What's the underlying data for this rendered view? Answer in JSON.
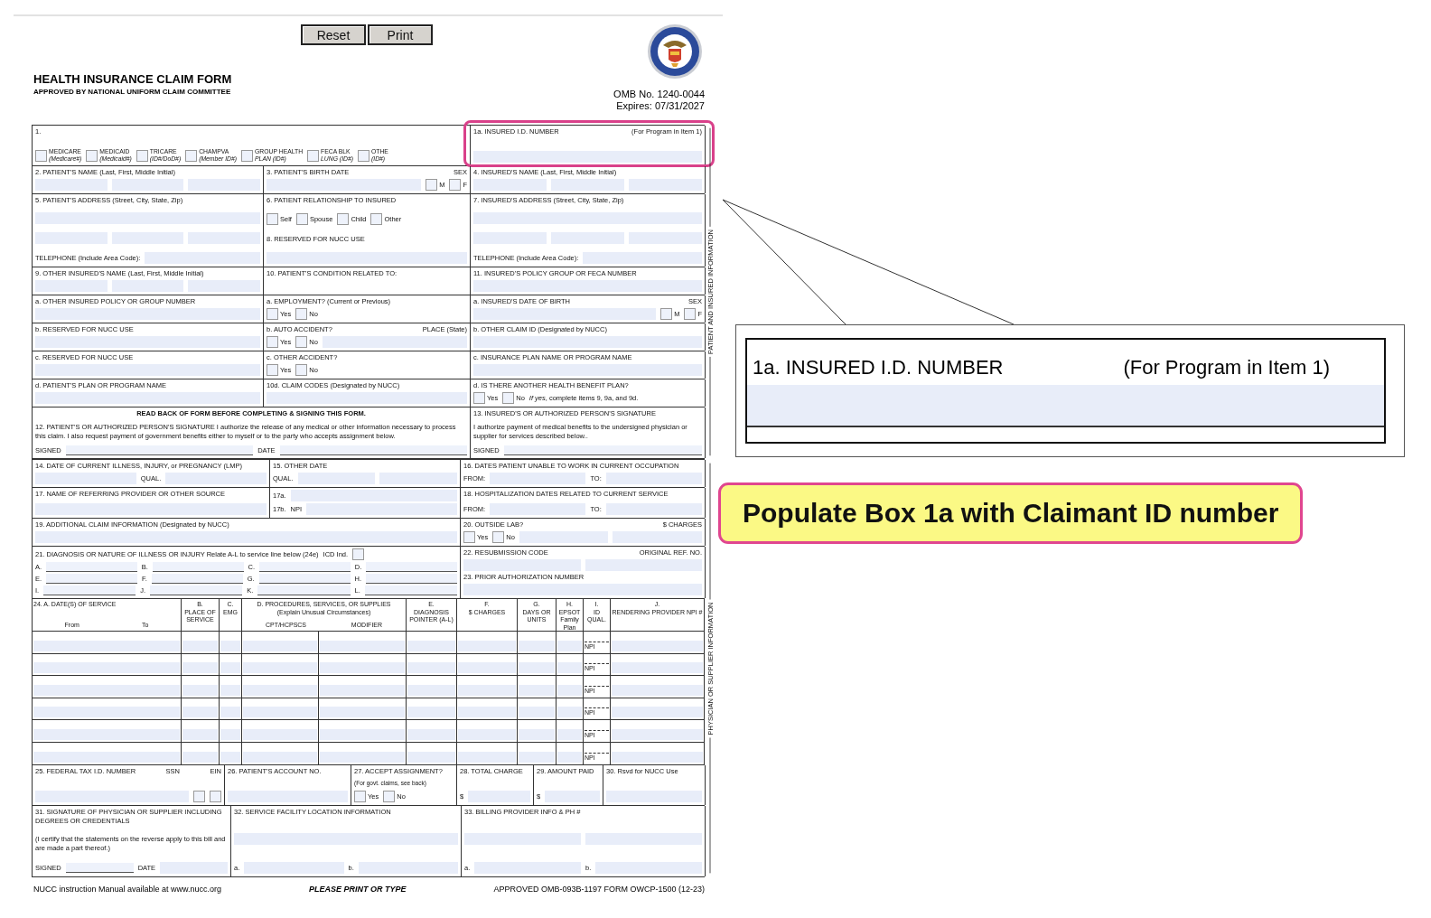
{
  "toolbar": {
    "buttons": [
      "Reset",
      "Print"
    ]
  },
  "header": {
    "title": "HEALTH INSURANCE CLAIM FORM",
    "subtitle": "APPROVED BY NATIONAL UNIFORM CLAIM COMMITTEE",
    "omb": "OMB No. 1240-0044",
    "expires": "Expires:  07/31/2027"
  },
  "form": {
    "sections": [
      {
        "side_label": "PATIENT AND INSURED INFORMATION",
        "rows": [
          {
            "kind": "cells",
            "cells": [
              {
                "highlighted": false,
                "lines": [
                  [
                    {
                      "kind": "label",
                      "text": "1."
                    }
                  ],
                  [
                    {
                      "kind": "check",
                      "label": "MEDICARE",
                      "sublabel": "(Medicare#)",
                      "checked": false
                    },
                    {
                      "kind": "check",
                      "label": "MEDICAID",
                      "sublabel": "(Medicaid#)",
                      "checked": false
                    },
                    {
                      "kind": "check",
                      "label": "TRICARE",
                      "sublabel": "(ID#/DoD#)",
                      "checked": false
                    },
                    {
                      "kind": "check",
                      "label": "CHAMPVA",
                      "sublabel": "(Member ID#)",
                      "checked": false
                    },
                    {
                      "kind": "check",
                      "label": "GROUP HEALTH",
                      "sublabel": "PLAN (ID#)",
                      "checked": false
                    },
                    {
                      "kind": "check",
                      "label": "FECA BLK",
                      "sublabel": "LUNG (ID#)",
                      "checked": false
                    },
                    {
                      "kind": "check",
                      "label": "OTHE",
                      "sublabel": "(ID#)",
                      "checked": false
                    }
                  ]
                ]
              },
              {
                "highlighted": true,
                "lines": [
                  [
                    {
                      "kind": "label",
                      "text": "1a. INSURED I.D. NUMBER"
                    },
                    {
                      "kind": "label",
                      "text": "(For Program in Item 1)"
                    }
                  ],
                  [
                    {
                      "kind": "field"
                    }
                  ]
                ]
              }
            ]
          },
          {
            "kind": "cells",
            "cells": [
              {
                "highlighted": false,
                "lines": [
                  [
                    {
                      "kind": "label",
                      "text": "2. PATIENT'S NAME (Last, First, Middle Initial)"
                    }
                  ],
                  [
                    {
                      "kind": "field"
                    },
                    {
                      "kind": "field"
                    },
                    {
                      "kind": "field"
                    }
                  ]
                ]
              },
              {
                "highlighted": false,
                "lines": [
                  [
                    {
                      "kind": "label",
                      "text": "3. PATIENT'S BIRTH DATE"
                    },
                    {
                      "kind": "label",
                      "text": "SEX"
                    }
                  ],
                  [
                    {
                      "kind": "field"
                    },
                    {
                      "kind": "check",
                      "label": "M",
                      "checked": false
                    },
                    {
                      "kind": "check",
                      "label": "F",
                      "checked": false
                    }
                  ]
                ]
              },
              {
                "highlighted": false,
                "lines": [
                  [
                    {
                      "kind": "label",
                      "text": "4. INSURED'S NAME (Last, First, Middle Initial)"
                    }
                  ],
                  [
                    {
                      "kind": "field"
                    },
                    {
                      "kind": "field"
                    },
                    {
                      "kind": "field"
                    }
                  ]
                ]
              }
            ]
          },
          {
            "kind": "cells",
            "cells": [
              {
                "highlighted": false,
                "lines": [
                  [
                    {
                      "kind": "label",
                      "text": "5. PATIENT'S ADDRESS (Street, City, State, Zip)"
                    }
                  ],
                  [
                    {
                      "kind": "field"
                    }
                  ],
                  [
                    {
                      "kind": "field"
                    },
                    {
                      "kind": "field"
                    },
                    {
                      "kind": "field"
                    }
                  ],
                  [
                    {
                      "kind": "label",
                      "text": "TELEPHONE (Include Area Code):"
                    },
                    {
                      "kind": "field"
                    }
                  ]
                ]
              },
              {
                "highlighted": false,
                "lines": [
                  [
                    {
                      "kind": "label",
                      "text": "6. PATIENT RELATIONSHIP TO INSURED"
                    }
                  ],
                  [
                    {
                      "kind": "check",
                      "label": "Self",
                      "checked": false
                    },
                    {
                      "kind": "check",
                      "label": "Spouse",
                      "checked": false
                    },
                    {
                      "kind": "check",
                      "label": "Child",
                      "checked": false
                    },
                    {
                      "kind": "check",
                      "label": "Other",
                      "checked": false
                    }
                  ],
                  [
                    {
                      "kind": "label",
                      "text": "8. RESERVED FOR NUCC USE"
                    }
                  ],
                  [
                    {
                      "kind": "field"
                    }
                  ]
                ]
              },
              {
                "highlighted": false,
                "lines": [
                  [
                    {
                      "kind": "label",
                      "text": "7. INSURED'S ADDRESS (Street, City, State, Zip)"
                    }
                  ],
                  [
                    {
                      "kind": "field"
                    }
                  ],
                  [
                    {
                      "kind": "field"
                    },
                    {
                      "kind": "field"
                    },
                    {
                      "kind": "field"
                    }
                  ],
                  [
                    {
                      "kind": "label",
                      "text": "TELEPHONE (Include Area Code):"
                    },
                    {
                      "kind": "field"
                    }
                  ]
                ]
              }
            ]
          },
          {
            "kind": "cells",
            "cells": [
              {
                "highlighted": false,
                "lines": [
                  [
                    {
                      "kind": "label",
                      "text": "9. OTHER INSURED'S NAME (Last, First, Middle Initial)"
                    }
                  ],
                  [
                    {
                      "kind": "field"
                    },
                    {
                      "kind": "field"
                    },
                    {
                      "kind": "field"
                    }
                  ]
                ]
              },
              {
                "highlighted": false,
                "lines": [
                  [
                    {
                      "kind": "label",
                      "text": "10. PATIENT'S CONDITION RELATED TO:"
                    }
                  ]
                ]
              },
              {
                "highlighted": false,
                "lines": [
                  [
                    {
                      "kind": "label",
                      "text": "11. INSURED'S POLICY GROUP OR FECA NUMBER"
                    }
                  ],
                  [
                    {
                      "kind": "field"
                    }
                  ]
                ]
              }
            ]
          },
          {
            "kind": "cells",
            "cells": [
              {
                "highlighted": false,
                "lines": [
                  [
                    {
                      "kind": "label",
                      "text": "a. OTHER INSURED POLICY OR GROUP NUMBER"
                    }
                  ],
                  [
                    {
                      "kind": "field"
                    }
                  ]
                ]
              },
              {
                "highlighted": false,
                "lines": [
                  [
                    {
                      "kind": "label",
                      "text": "a. EMPLOYMENT? (Current or Previous)"
                    }
                  ],
                  [
                    {
                      "kind": "check",
                      "label": "Yes",
                      "checked": false
                    },
                    {
                      "kind": "check",
                      "label": "No",
                      "checked": false
                    }
                  ]
                ]
              },
              {
                "highlighted": false,
                "lines": [
                  [
                    {
                      "kind": "label",
                      "text": "a. INSURED'S DATE OF BIRTH"
                    },
                    {
                      "kind": "label",
                      "text": "SEX"
                    }
                  ],
                  [
                    {
                      "kind": "field"
                    },
                    {
                      "kind": "check",
                      "label": "M",
                      "checked": false
                    },
                    {
                      "kind": "check",
                      "label": "F",
                      "checked": false
                    }
                  ]
                ]
              }
            ]
          },
          {
            "kind": "cells",
            "cells": [
              {
                "highlighted": false,
                "lines": [
                  [
                    {
                      "kind": "label",
                      "text": "b. RESERVED FOR NUCC USE"
                    }
                  ],
                  [
                    {
                      "kind": "field"
                    }
                  ]
                ]
              },
              {
                "highlighted": false,
                "lines": [
                  [
                    {
                      "kind": "label",
                      "text": "b. AUTO ACCIDENT?"
                    },
                    {
                      "kind": "label",
                      "text": "PLACE (State)"
                    }
                  ],
                  [
                    {
                      "kind": "check",
                      "label": "Yes",
                      "checked": false
                    },
                    {
                      "kind": "check",
                      "label": "No",
                      "checked": false
                    },
                    {
                      "kind": "field"
                    }
                  ]
                ]
              },
              {
                "highlighted": false,
                "lines": [
                  [
                    {
                      "kind": "label",
                      "text": "b. OTHER CLAIM ID (Designated by NUCC)"
                    }
                  ],
                  [
                    {
                      "kind": "field"
                    }
                  ]
                ]
              }
            ]
          },
          {
            "kind": "cells",
            "cells": [
              {
                "highlighted": false,
                "lines": [
                  [
                    {
                      "kind": "label",
                      "text": "c. RESERVED FOR NUCC USE"
                    }
                  ],
                  [
                    {
                      "kind": "field"
                    }
                  ]
                ]
              },
              {
                "highlighted": false,
                "lines": [
                  [
                    {
                      "kind": "label",
                      "text": "c. OTHER ACCIDENT?"
                    }
                  ],
                  [
                    {
                      "kind": "check",
                      "label": "Yes",
                      "checked": false
                    },
                    {
                      "kind": "check",
                      "label": "No",
                      "checked": false
                    }
                  ]
                ]
              },
              {
                "highlighted": false,
                "lines": [
                  [
                    {
                      "kind": "label",
                      "text": "c. INSURANCE PLAN NAME OR PROGRAM NAME"
                    }
                  ],
                  [
                    {
                      "kind": "field"
                    }
                  ]
                ]
              }
            ]
          },
          {
            "kind": "cells",
            "cells": [
              {
                "highlighted": false,
                "lines": [
                  [
                    {
                      "kind": "label",
                      "text": "d. PATIENT'S PLAN OR PROGRAM NAME"
                    }
                  ],
                  [
                    {
                      "kind": "field"
                    }
                  ]
                ]
              },
              {
                "highlighted": false,
                "lines": [
                  [
                    {
                      "kind": "label",
                      "text": "10d. CLAIM CODES (Designated by NUCC)"
                    }
                  ],
                  [
                    {
                      "kind": "field"
                    }
                  ]
                ]
              },
              {
                "highlighted": false,
                "lines": [
                  [
                    {
                      "kind": "label",
                      "text": "d. IS THERE ANOTHER HEALTH BENEFIT PLAN?"
                    }
                  ],
                  [
                    {
                      "kind": "check",
                      "label": "Yes",
                      "checked": false
                    },
                    {
                      "kind": "check",
                      "label": "No",
                      "checked": false
                    },
                    {
                      "kind": "label",
                      "text": "*If yes*, complete items 9, 9a, and 9d."
                    }
                  ]
                ]
              }
            ]
          },
          {
            "kind": "cells",
            "cells": [
              {
                "highlighted": false,
                "lines": [
                  [
                    {
                      "kind": "bold",
                      "text": "READ BACK OF FORM BEFORE COMPLETING & SIGNING THIS FORM."
                    }
                  ],
                  [
                    {
                      "kind": "para",
                      "text": "12. PATIENT'S OR AUTHORIZED PERSON'S SIGNATURE I authorize the release of any medical or other information necessary to process this claim. I also request payment of government benefits either to myself or to the party who accepts assignment below."
                    }
                  ],
                  [
                    {
                      "kind": "label",
                      "text": "SIGNED"
                    },
                    {
                      "kind": "line"
                    },
                    {
                      "kind": "label",
                      "text": "DATE"
                    },
                    {
                      "kind": "line"
                    }
                  ]
                ]
              },
              {
                "highlighted": false,
                "lines": [
                  [
                    {
                      "kind": "label",
                      "text": "13. INSURED'S OR AUTHORIZED PERSON'S SIGNATURE"
                    }
                  ],
                  [
                    {
                      "kind": "para",
                      "text": "I authorize payment of medical benefits to the undersigned physician or supplier for services described below.."
                    }
                  ],
                  [
                    {
                      "kind": "label",
                      "text": "SIGNED"
                    },
                    {
                      "kind": "line"
                    }
                  ]
                ]
              }
            ]
          }
        ]
      },
      {
        "side_label": "PHYSICIAN OR SUPPLIER INFORMATION",
        "rows": [
          {
            "kind": "cells",
            "cells": [
              {
                "highlighted": false,
                "lines": [
                  [
                    {
                      "kind": "label",
                      "text": "14. DATE OF CURRENT ILLNESS, INJURY, or PREGNANCY (LMP)"
                    }
                  ],
                  [
                    {
                      "kind": "field"
                    },
                    {
                      "kind": "label",
                      "text": "QUAL."
                    },
                    {
                      "kind": "field"
                    }
                  ]
                ]
              },
              {
                "highlighted": false,
                "lines": [
                  [
                    {
                      "kind": "label",
                      "text": "15. OTHER DATE"
                    }
                  ],
                  [
                    {
                      "kind": "label",
                      "text": "QUAL."
                    },
                    {
                      "kind": "field"
                    },
                    {
                      "kind": "field"
                    }
                  ]
                ]
              },
              {
                "highlighted": false,
                "lines": [
                  [
                    {
                      "kind": "label",
                      "text": "16. DATES PATIENT UNABLE TO WORK IN CURRENT OCCUPATION"
                    }
                  ],
                  [
                    {
                      "kind": "label",
                      "text": "FROM:"
                    },
                    {
                      "kind": "field"
                    },
                    {
                      "kind": "label",
                      "text": "TO:"
                    },
                    {
                      "kind": "field"
                    }
                  ]
                ]
              }
            ]
          },
          {
            "kind": "cells",
            "cells": [
              {
                "highlighted": false,
                "lines": [
                  [
                    {
                      "kind": "label",
                      "text": "17. NAME OF REFERRING PROVIDER OR OTHER SOURCE"
                    }
                  ],
                  [
                    {
                      "kind": "field"
                    }
                  ]
                ]
              },
              {
                "highlighted": false,
                "lines": [
                  [
                    {
                      "kind": "label",
                      "text": "17a."
                    },
                    {
                      "kind": "field"
                    }
                  ],
                  [
                    {
                      "kind": "label",
                      "text": "17b."
                    },
                    {
                      "kind": "label",
                      "text": "NPI"
                    },
                    {
                      "kind": "field"
                    }
                  ]
                ]
              },
              {
                "highlighted": false,
                "lines": [
                  [
                    {
                      "kind": "label",
                      "text": "18. HOSPITALIZATION DATES RELATED TO CURRENT SERVICE"
                    }
                  ],
                  [
                    {
                      "kind": "label",
                      "text": "FROM:"
                    },
                    {
                      "kind": "field"
                    },
                    {
                      "kind": "label",
                      "text": "TO:"
                    },
                    {
                      "kind": "field"
                    }
                  ]
                ]
              }
            ]
          },
          {
            "kind": "cells",
            "cells": [
              {
                "highlighted": false,
                "lines": [
                  [
                    {
                      "kind": "label",
                      "text": "19. ADDITIONAL CLAIM INFORMATION (Designated by NUCC)"
                    }
                  ],
                  [
                    {
                      "kind": "field"
                    }
                  ]
                ]
              },
              {
                "highlighted": false,
                "lines": [
                  [
                    {
                      "kind": "label",
                      "text": "20. OUTSIDE LAB?"
                    },
                    {
                      "kind": "label",
                      "text": "$ CHARGES"
                    }
                  ],
                  [
                    {
                      "kind": "check",
                      "label": "Yes",
                      "checked": false
                    },
                    {
                      "kind": "check",
                      "label": "No",
                      "checked": false
                    },
                    {
                      "kind": "field"
                    },
                    {
                      "kind": "field"
                    }
                  ]
                ]
              }
            ]
          },
          {
            "kind": "cells",
            "cells": [
              {
                "highlighted": false,
                "lines": [
                  [
                    {
                      "kind": "label",
                      "text": "21. DIAGNOSIS OR NATURE OF ILLNESS OR INJURY Relate A-L to service line below (24e)"
                    },
                    {
                      "kind": "label",
                      "text": "ICD Ind."
                    },
                    {
                      "kind": "check",
                      "checked": false
                    }
                  ],
                  [
                    {
                      "kind": "label",
                      "text": "A."
                    },
                    {
                      "kind": "line"
                    },
                    {
                      "kind": "label",
                      "text": "B."
                    },
                    {
                      "kind": "line"
                    },
                    {
                      "kind": "label",
                      "text": "C."
                    },
                    {
                      "kind": "line"
                    },
                    {
                      "kind": "label",
                      "text": "D."
                    },
                    {
                      "kind": "line"
                    }
                  ],
                  [
                    {
                      "kind": "label",
                      "text": "E."
                    },
                    {
                      "kind": "line"
                    },
                    {
                      "kind": "label",
                      "text": "F."
                    },
                    {
                      "kind": "line"
                    },
                    {
                      "kind": "label",
                      "text": "G."
                    },
                    {
                      "kind": "line"
                    },
                    {
                      "kind": "label",
                      "text": "H."
                    },
                    {
                      "kind": "line"
                    }
                  ],
                  [
                    {
                      "kind": "label",
                      "text": "I."
                    },
                    {
                      "kind": "line"
                    },
                    {
                      "kind": "label",
                      "text": "J."
                    },
                    {
                      "kind": "line"
                    },
                    {
                      "kind": "label",
                      "text": "K."
                    },
                    {
                      "kind": "line"
                    },
                    {
                      "kind": "label",
                      "text": "L."
                    },
                    {
                      "kind": "line"
                    }
                  ]
                ]
              },
              {
                "highlighted": false,
                "lines": [
                  [
                    {
                      "kind": "label",
                      "text": "22. RESUBMISSION CODE"
                    },
                    {
                      "kind": "label",
                      "text": "ORIGINAL REF. NO."
                    }
                  ],
                  [
                    {
                      "kind": "field"
                    },
                    {
                      "kind": "field"
                    }
                  ],
                  [
                    {
                      "kind": "label",
                      "text": "23. PRIOR AUTHORIZATION NUMBER"
                    }
                  ],
                  [
                    {
                      "kind": "field"
                    }
                  ]
                ]
              }
            ]
          },
          {
            "kind": "table",
            "columns": [
              {
                "lines": [
                  "24. A. DATE(S) OF SERVICE"
                ],
                "sub": [
                  "From",
                  "To"
                ]
              },
              {
                "lines": [
                  "B.",
                  "PLACE OF SERVICE"
                ]
              },
              {
                "lines": [
                  "C.",
                  "EMG"
                ]
              },
              {
                "lines": [
                  "D. PROCEDURES, SERVICES, OR SUPPLIES",
                  "(Explain Unusual Circumstances)"
                ],
                "sub": [
                  "CPT/HCPSCS",
                  "MODIFIER"
                ]
              },
              {
                "lines": [
                  "E.",
                  "DIAGNOSIS POINTER (A-L)"
                ]
              },
              {
                "lines": [
                  "F.",
                  "$ CHARGES"
                ]
              },
              {
                "lines": [
                  "G.",
                  "DAYS OR UNITS"
                ]
              },
              {
                "lines": [
                  "H.",
                  "EPSOT Family Plan"
                ]
              },
              {
                "lines": [
                  "I.",
                  "ID QUAL."
                ]
              },
              {
                "lines": [
                  "J.",
                  "RENDERING PROVIDER NPI #"
                ]
              }
            ],
            "rows": [
              {
                "qualifier": "NPI"
              },
              {
                "qualifier": "NPI"
              },
              {
                "qualifier": "NPI"
              },
              {
                "qualifier": "NPI"
              },
              {
                "qualifier": "NPI"
              },
              {
                "qualifier": "NPI"
              }
            ]
          },
          {
            "kind": "cells",
            "cells": [
              {
                "highlighted": false,
                "lines": [
                  [
                    {
                      "kind": "label",
                      "text": "25. FEDERAL TAX I.D. NUMBER"
                    },
                    {
                      "kind": "label",
                      "text": "SSN"
                    },
                    {
                      "kind": "label",
                      "text": "EIN"
                    }
                  ],
                  [
                    {
                      "kind": "field"
                    },
                    {
                      "kind": "check",
                      "checked": false
                    },
                    {
                      "kind": "check",
                      "checked": false
                    }
                  ]
                ]
              },
              {
                "highlighted": false,
                "lines": [
                  [
                    {
                      "kind": "label",
                      "text": "26. PATIENT'S ACCOUNT NO."
                    }
                  ],
                  [
                    {
                      "kind": "field"
                    }
                  ]
                ]
              },
              {
                "highlighted": false,
                "lines": [
                  [
                    {
                      "kind": "label",
                      "text": "27. ACCEPT ASSIGNMENT?"
                    }
                  ],
                  [
                    {
                      "kind": "small",
                      "text": "(For govt. claims, see back)"
                    }
                  ],
                  [
                    {
                      "kind": "check",
                      "label": "Yes",
                      "checked": false
                    },
                    {
                      "kind": "check",
                      "label": "No",
                      "checked": false
                    }
                  ]
                ]
              },
              {
                "highlighted": false,
                "lines": [
                  [
                    {
                      "kind": "label",
                      "text": "28. TOTAL CHARGE"
                    }
                  ],
                  [
                    {
                      "kind": "label",
                      "text": "$"
                    },
                    {
                      "kind": "field"
                    }
                  ]
                ]
              },
              {
                "highlighted": false,
                "lines": [
                  [
                    {
                      "kind": "label",
                      "text": "29. AMOUNT PAID"
                    }
                  ],
                  [
                    {
                      "kind": "label",
                      "text": "$"
                    },
                    {
                      "kind": "field"
                    }
                  ]
                ]
              },
              {
                "highlighted": false,
                "lines": [
                  [
                    {
                      "kind": "label",
                      "text": "30. Rsvd for NUCC Use"
                    }
                  ],
                  [
                    {
                      "kind": "field"
                    }
                  ]
                ]
              }
            ]
          },
          {
            "kind": "cells",
            "cells": [
              {
                "highlighted": false,
                "lines": [
                  [
                    {
                      "kind": "para",
                      "text": "31. SIGNATURE OF PHYSICIAN OR SUPPLIER INCLUDING DEGREES OR CREDENTIALS"
                    }
                  ],
                  [
                    {
                      "kind": "para",
                      "text": "(I certify that the statements on the reverse apply to this bill and are made a part thereof.)"
                    }
                  ],
                  [
                    {
                      "kind": "label",
                      "text": "SIGNED"
                    },
                    {
                      "kind": "line"
                    },
                    {
                      "kind": "label",
                      "text": "DATE"
                    },
                    {
                      "kind": "field"
                    }
                  ]
                ]
              },
              {
                "highlighted": false,
                "lines": [
                  [
                    {
                      "kind": "label",
                      "text": "32. SERVICE FACILITY LOCATION INFORMATION"
                    }
                  ],
                  [
                    {
                      "kind": "field"
                    }
                  ],
                  [
                    {
                      "kind": "label",
                      "text": "a."
                    },
                    {
                      "kind": "field"
                    },
                    {
                      "kind": "label",
                      "text": "b."
                    },
                    {
                      "kind": "field"
                    }
                  ]
                ]
              },
              {
                "highlighted": false,
                "lines": [
                  [
                    {
                      "kind": "label",
                      "text": "33. BILLING PROVIDER INFO & PH #"
                    }
                  ],
                  [
                    {
                      "kind": "field"
                    },
                    {
                      "kind": "field"
                    }
                  ],
                  [
                    {
                      "kind": "label",
                      "text": "a."
                    },
                    {
                      "kind": "field"
                    },
                    {
                      "kind": "label",
                      "text": "b."
                    },
                    {
                      "kind": "field"
                    }
                  ]
                ]
              }
            ]
          }
        ]
      }
    ]
  },
  "footer": [
    {
      "kind": "note",
      "text": "NUCC instruction Manual available at www.nucc.org"
    },
    {
      "kind": "emphasis",
      "text": "PLEASE PRINT OR TYPE"
    },
    {
      "kind": "note",
      "text": "APPROVED OMB-093B-1197 FORM OWCP-1500 (12-23)"
    }
  ],
  "callout": {
    "label": "1a. INSURED I.D. NUMBER",
    "note": "(For Program in Item 1)"
  },
  "note": "Populate Box 1a with Claimant ID number"
}
